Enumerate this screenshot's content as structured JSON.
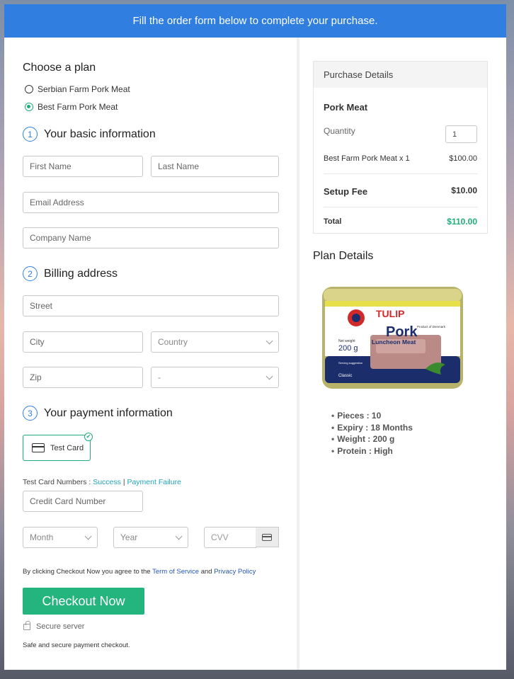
{
  "banner": "Fill the order form below to complete your purchase.",
  "plan": {
    "heading": "Choose a plan",
    "options": [
      "Serbian Farm Pork Meat",
      "Best Farm Pork Meat"
    ],
    "selected_index": 1
  },
  "sections": [
    {
      "num": "1",
      "title": "Your basic information"
    },
    {
      "num": "2",
      "title": "Billing address"
    },
    {
      "num": "3",
      "title": "Your payment information"
    }
  ],
  "fields": {
    "first_name": "First Name",
    "last_name": "Last Name",
    "email": "Email Address",
    "company": "Company Name",
    "street": "Street",
    "city": "City",
    "country": "Country",
    "zip": "Zip",
    "state": "-",
    "card_number": "Credit Card Number",
    "month": "Month",
    "year": "Year",
    "cvv": "CVV"
  },
  "payment": {
    "method_label": "Test Card",
    "test_numbers_label": "Test Card Numbers :",
    "success_link": "Success",
    "separator": "|",
    "failure_link": "Payment Failure"
  },
  "terms": {
    "prefix": "By clicking Checkout Now you agree to the",
    "tos_link": "Term of Service",
    "and": "and",
    "privacy_link": "Privacy Policy"
  },
  "checkout_label": "Checkout Now",
  "secure_label": "Secure server",
  "safe_label": "Safe and secure payment checkout.",
  "purchase": {
    "heading": "Purchase Details",
    "product": "Pork Meat",
    "quantity_label": "Quantity",
    "quantity_value": "1",
    "line_item": "Best Farm Pork Meat x 1",
    "line_price": "$100.00",
    "setup_label": "Setup Fee",
    "setup_price": "$10.00",
    "total_label": "Total",
    "total_price": "$110.00"
  },
  "plan_details": {
    "heading": "Plan Details",
    "image_text": {
      "brand": "TULIP",
      "name": "Pork",
      "sub": "Luncheon Meat",
      "weight_label": "Net weight",
      "weight": "200 g",
      "origin": "Product of Denmark",
      "variant": "Classic",
      "serving": "Serving suggestion"
    },
    "bullets": [
      "Pieces : 10",
      "Expiry : 18 Months",
      "Weight : 200 g",
      "Protein : High"
    ]
  },
  "colors": {
    "accent_blue": "#2f7ee0",
    "accent_green": "#24b47e",
    "link_teal": "#1fa3b8",
    "total_green": "#1fae78"
  }
}
